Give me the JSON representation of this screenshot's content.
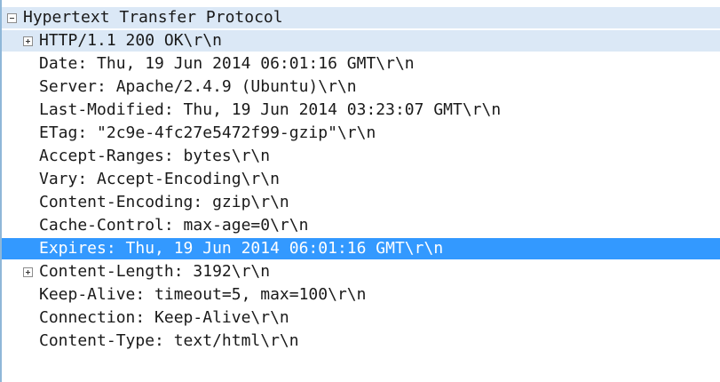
{
  "packet_details": {
    "root": {
      "label": "Hypertext Transfer Protocol",
      "expanded": true
    },
    "rows": [
      {
        "label": "HTTP/1.1 200 OK\\r\\n",
        "expander": "plus"
      },
      {
        "label": "Date: Thu, 19 Jun 2014 06:01:16 GMT\\r\\n"
      },
      {
        "label": "Server: Apache/2.4.9 (Ubuntu)\\r\\n"
      },
      {
        "label": "Last-Modified: Thu, 19 Jun 2014 03:23:07 GMT\\r\\n"
      },
      {
        "label": "ETag: \"2c9e-4fc27e5472f99-gzip\"\\r\\n"
      },
      {
        "label": "Accept-Ranges: bytes\\r\\n"
      },
      {
        "label": "Vary: Accept-Encoding\\r\\n"
      },
      {
        "label": "Content-Encoding: gzip\\r\\n"
      },
      {
        "label": "Cache-Control: max-age=0\\r\\n"
      },
      {
        "label": "Expires: Thu, 19 Jun 2014 06:01:16 GMT\\r\\n",
        "selected": true
      },
      {
        "label": "Content-Length: 3192\\r\\n",
        "expander": "plus"
      },
      {
        "label": "Keep-Alive: timeout=5, max=100\\r\\n"
      },
      {
        "label": "Connection: Keep-Alive\\r\\n"
      },
      {
        "label": "Content-Type: text/html\\r\\n"
      }
    ]
  },
  "colors": {
    "selection": "#3399ff",
    "group_highlight": "#dbe8f6"
  }
}
